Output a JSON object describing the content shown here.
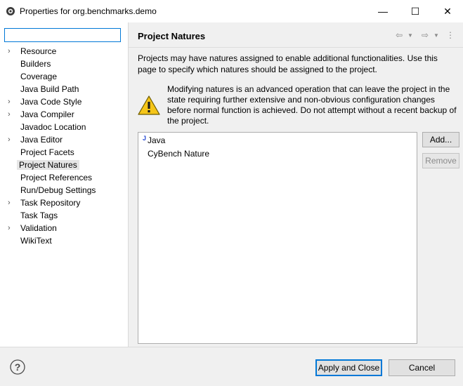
{
  "window": {
    "title": "Properties for org.benchmarks.demo",
    "minimize_glyph": "—",
    "maximize_glyph": "☐",
    "close_glyph": "✕"
  },
  "sidebar": {
    "filter": {
      "value": "",
      "placeholder": ""
    },
    "items": [
      {
        "label": "Resource",
        "expandable": true,
        "selected": false
      },
      {
        "label": "Builders",
        "expandable": false,
        "selected": false
      },
      {
        "label": "Coverage",
        "expandable": false,
        "selected": false
      },
      {
        "label": "Java Build Path",
        "expandable": false,
        "selected": false
      },
      {
        "label": "Java Code Style",
        "expandable": true,
        "selected": false
      },
      {
        "label": "Java Compiler",
        "expandable": true,
        "selected": false
      },
      {
        "label": "Javadoc Location",
        "expandable": false,
        "selected": false
      },
      {
        "label": "Java Editor",
        "expandable": true,
        "selected": false
      },
      {
        "label": "Project Facets",
        "expandable": false,
        "selected": false
      },
      {
        "label": "Project Natures",
        "expandable": false,
        "selected": true
      },
      {
        "label": "Project References",
        "expandable": false,
        "selected": false
      },
      {
        "label": "Run/Debug Settings",
        "expandable": false,
        "selected": false
      },
      {
        "label": "Task Repository",
        "expandable": true,
        "selected": false
      },
      {
        "label": "Task Tags",
        "expandable": false,
        "selected": false
      },
      {
        "label": "Validation",
        "expandable": true,
        "selected": false
      },
      {
        "label": "WikiText",
        "expandable": false,
        "selected": false
      }
    ],
    "arrow_glyph": "›"
  },
  "page": {
    "title": "Project Natures",
    "description": "Projects may have natures assigned to enable additional functionalities. Use this page to specify which natures should be assigned to the project.",
    "warning": "Modifying natures is an advanced operation that can leave the project in the state requiring further extensive and non-obvious configuration changes before normal function is achieved. Do not attempt without a recent backup of the project.",
    "natures": [
      {
        "label": "Java",
        "decoration": "J"
      },
      {
        "label": "CyBench Nature",
        "decoration": ""
      }
    ],
    "add_label": "Add...",
    "remove_label": "Remove",
    "nav": {
      "back_glyph": "⇦",
      "forward_glyph": "⇨",
      "menu_glyph": "▼",
      "view_menu_glyph": "⋮"
    }
  },
  "footer": {
    "help_glyph": "?",
    "apply_close_label": "Apply and Close",
    "cancel_label": "Cancel"
  },
  "colors": {
    "focus_blue": "#0078d7",
    "panel_bg": "#f0f0f0",
    "warning_yellow": "#f5c518"
  }
}
